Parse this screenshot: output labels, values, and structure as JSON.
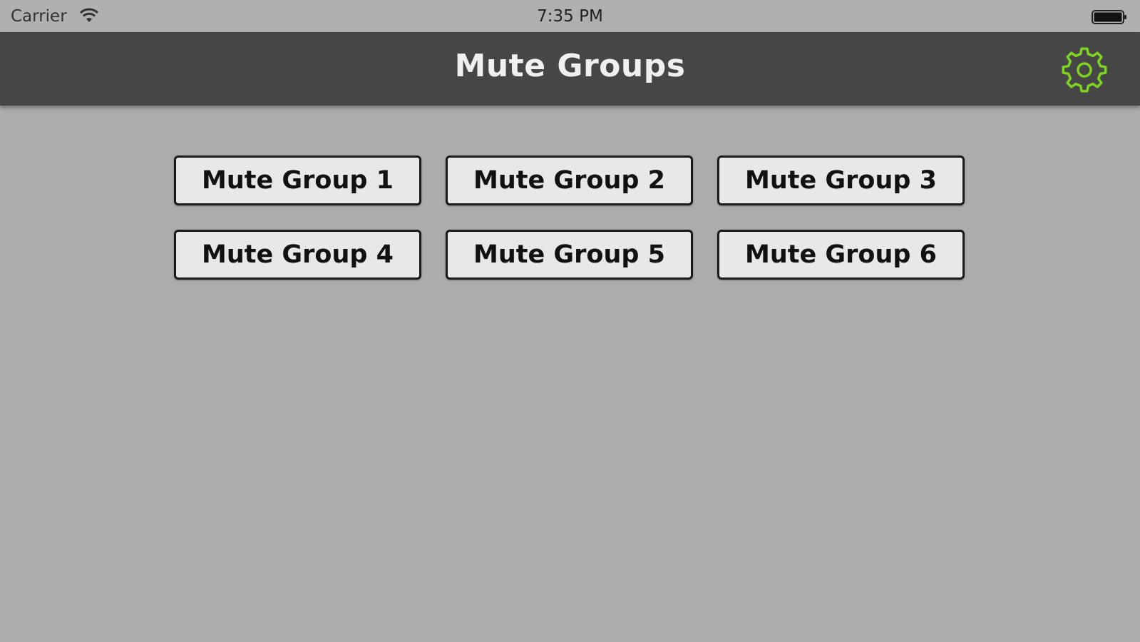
{
  "status_bar": {
    "carrier": "Carrier",
    "time": "7:35 PM",
    "wifi_icon": "wifi-icon",
    "battery_icon": "battery-icon"
  },
  "nav_bar": {
    "title": "Mute Groups",
    "settings_icon": "gear-icon",
    "accent_color": "#7ed321"
  },
  "mute_groups": [
    {
      "label": "Mute Group 1"
    },
    {
      "label": "Mute Group 2"
    },
    {
      "label": "Mute Group 3"
    },
    {
      "label": "Mute Group 4"
    },
    {
      "label": "Mute Group 5"
    },
    {
      "label": "Mute Group 6"
    }
  ]
}
